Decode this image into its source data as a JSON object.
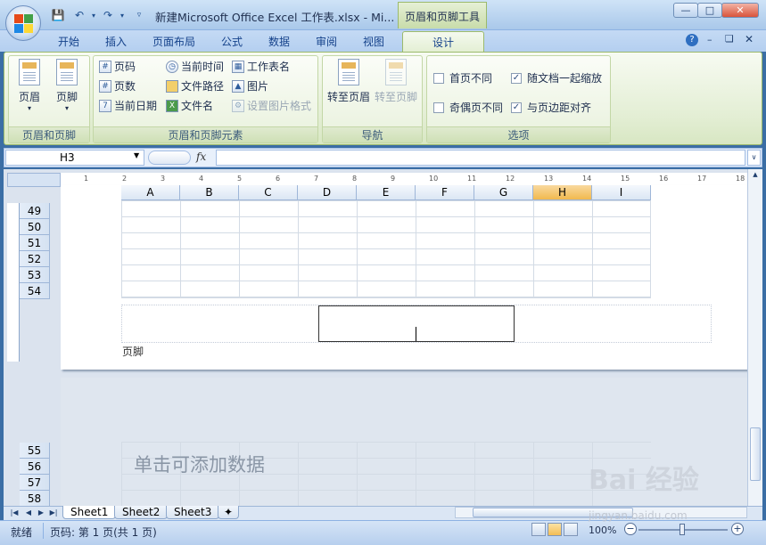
{
  "window": {
    "title": "新建Microsoft Office Excel 工作表.xlsx - Mi...",
    "context_tab": "页眉和页脚工具"
  },
  "tabs": [
    "开始",
    "插入",
    "页面布局",
    "公式",
    "数据",
    "审阅",
    "视图",
    "设计"
  ],
  "active_tab": "设计",
  "ribbon": {
    "groups": {
      "header_footer": {
        "label": "页眉和页脚",
        "header_btn": "页眉",
        "footer_btn": "页脚"
      },
      "elements": {
        "label": "页眉和页脚元素",
        "page_number": "页码",
        "page_count": "页数",
        "current_date": "当前日期",
        "current_time": "当前时间",
        "file_path": "文件路径",
        "file_name": "文件名",
        "sheet_name": "工作表名",
        "picture": "图片",
        "format_picture": "设置图片格式"
      },
      "navigation": {
        "label": "导航",
        "goto_header": "转至页眉",
        "goto_footer": "转至页脚"
      },
      "options": {
        "label": "选项",
        "first_page": "首页不同",
        "odd_even": "奇偶页不同",
        "scale_with_doc": "随文档一起缩放",
        "align_margins": "与页边距对齐"
      }
    }
  },
  "formula_bar": {
    "name_box": "H3",
    "fx": "fx"
  },
  "columns": [
    "A",
    "B",
    "C",
    "D",
    "E",
    "F",
    "G",
    "H",
    "I"
  ],
  "selected_column": "H",
  "rows_page1": [
    "49",
    "50",
    "51",
    "52",
    "53",
    "54"
  ],
  "rows_page2": [
    "55",
    "56",
    "57",
    "58"
  ],
  "ruler_numbers": [
    "1",
    "2",
    "3",
    "4",
    "5",
    "6",
    "7",
    "8",
    "9",
    "10",
    "11",
    "12",
    "13",
    "14",
    "15",
    "16",
    "17",
    "18"
  ],
  "footer_label": "页脚",
  "add_data_hint": "单击可添加数据",
  "sheets": [
    "Sheet1",
    "Sheet2",
    "Sheet3"
  ],
  "active_sheet": "Sheet1",
  "status": {
    "ready": "就绪",
    "page_info": "页码: 第 1 页(共 1 页)",
    "zoom": "100%"
  },
  "watermark": {
    "text": "Bai 经验",
    "url": "jingyan.baidu.com"
  }
}
